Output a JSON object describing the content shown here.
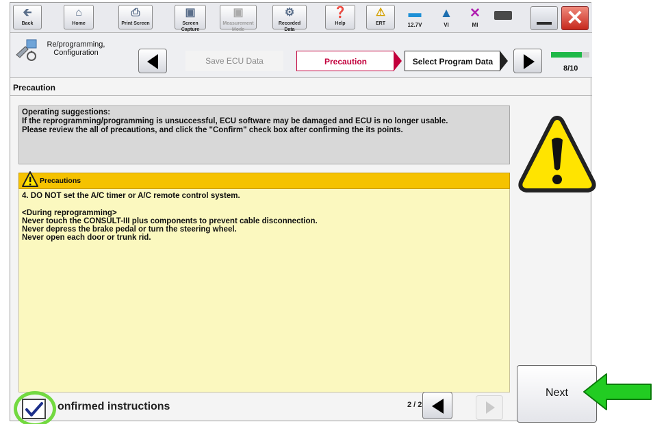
{
  "toolbar": {
    "buttons": [
      {
        "label": "Back",
        "icon": "back-arrow-icon"
      },
      {
        "label": "Home",
        "icon": "home-icon"
      },
      {
        "label": "Print Screen",
        "icon": "printer-icon"
      },
      {
        "label": "Screen Capture",
        "icon": "camera-icon"
      },
      {
        "label": "Measurement Mode",
        "icon": "measurement-icon",
        "disabled": true
      },
      {
        "label": "Recorded Data",
        "icon": "recorded-data-icon"
      },
      {
        "label": "Help",
        "icon": "help-icon"
      },
      {
        "label": "ERT",
        "icon": "warning-icon"
      }
    ],
    "status": {
      "battery_voltage": "12.7V",
      "vi_label": "VI",
      "mi_label": "MI"
    }
  },
  "stepbar": {
    "mode_label": "Re/programming, Configuration",
    "steps": {
      "done": "Save ECU Data",
      "active": "Precaution",
      "next": "Select Program Data"
    },
    "progress": {
      "text": "8/10",
      "fraction": 0.8
    }
  },
  "screen": {
    "title": "Precaution"
  },
  "suggestions": {
    "heading": "Operating suggestions:",
    "line1": "If the reprogramming/programming is unsuccessful, ECU software may be damaged and ECU is no longer usable.",
    "line2": "Please review the all of precautions, and click the \"Confirm\" check box after confirming the its points."
  },
  "precautions": {
    "header": "Precautions",
    "item": "4. DO NOT set the A/C timer or A/C remote control system.",
    "section": "<During  reprogramming>",
    "lines": [
      "Never touch the CONSULT-III plus components to prevent cable disconnection.",
      "Never depress the brake pedal or turn the steering wheel.",
      "Never open each door or trunk rid."
    ]
  },
  "footer": {
    "confirm_label": "onfirmed instructions",
    "confirmed": true,
    "page_count": "2 / 2",
    "next_label": "Next"
  },
  "colors": {
    "precaution_header": "#f5c200",
    "precaution_body": "#fbf8bf",
    "active_step": "#c2003c",
    "progress_fill": "#1fb848",
    "highlight_ring": "#73d940",
    "pointer_arrow": "#22cc22"
  }
}
